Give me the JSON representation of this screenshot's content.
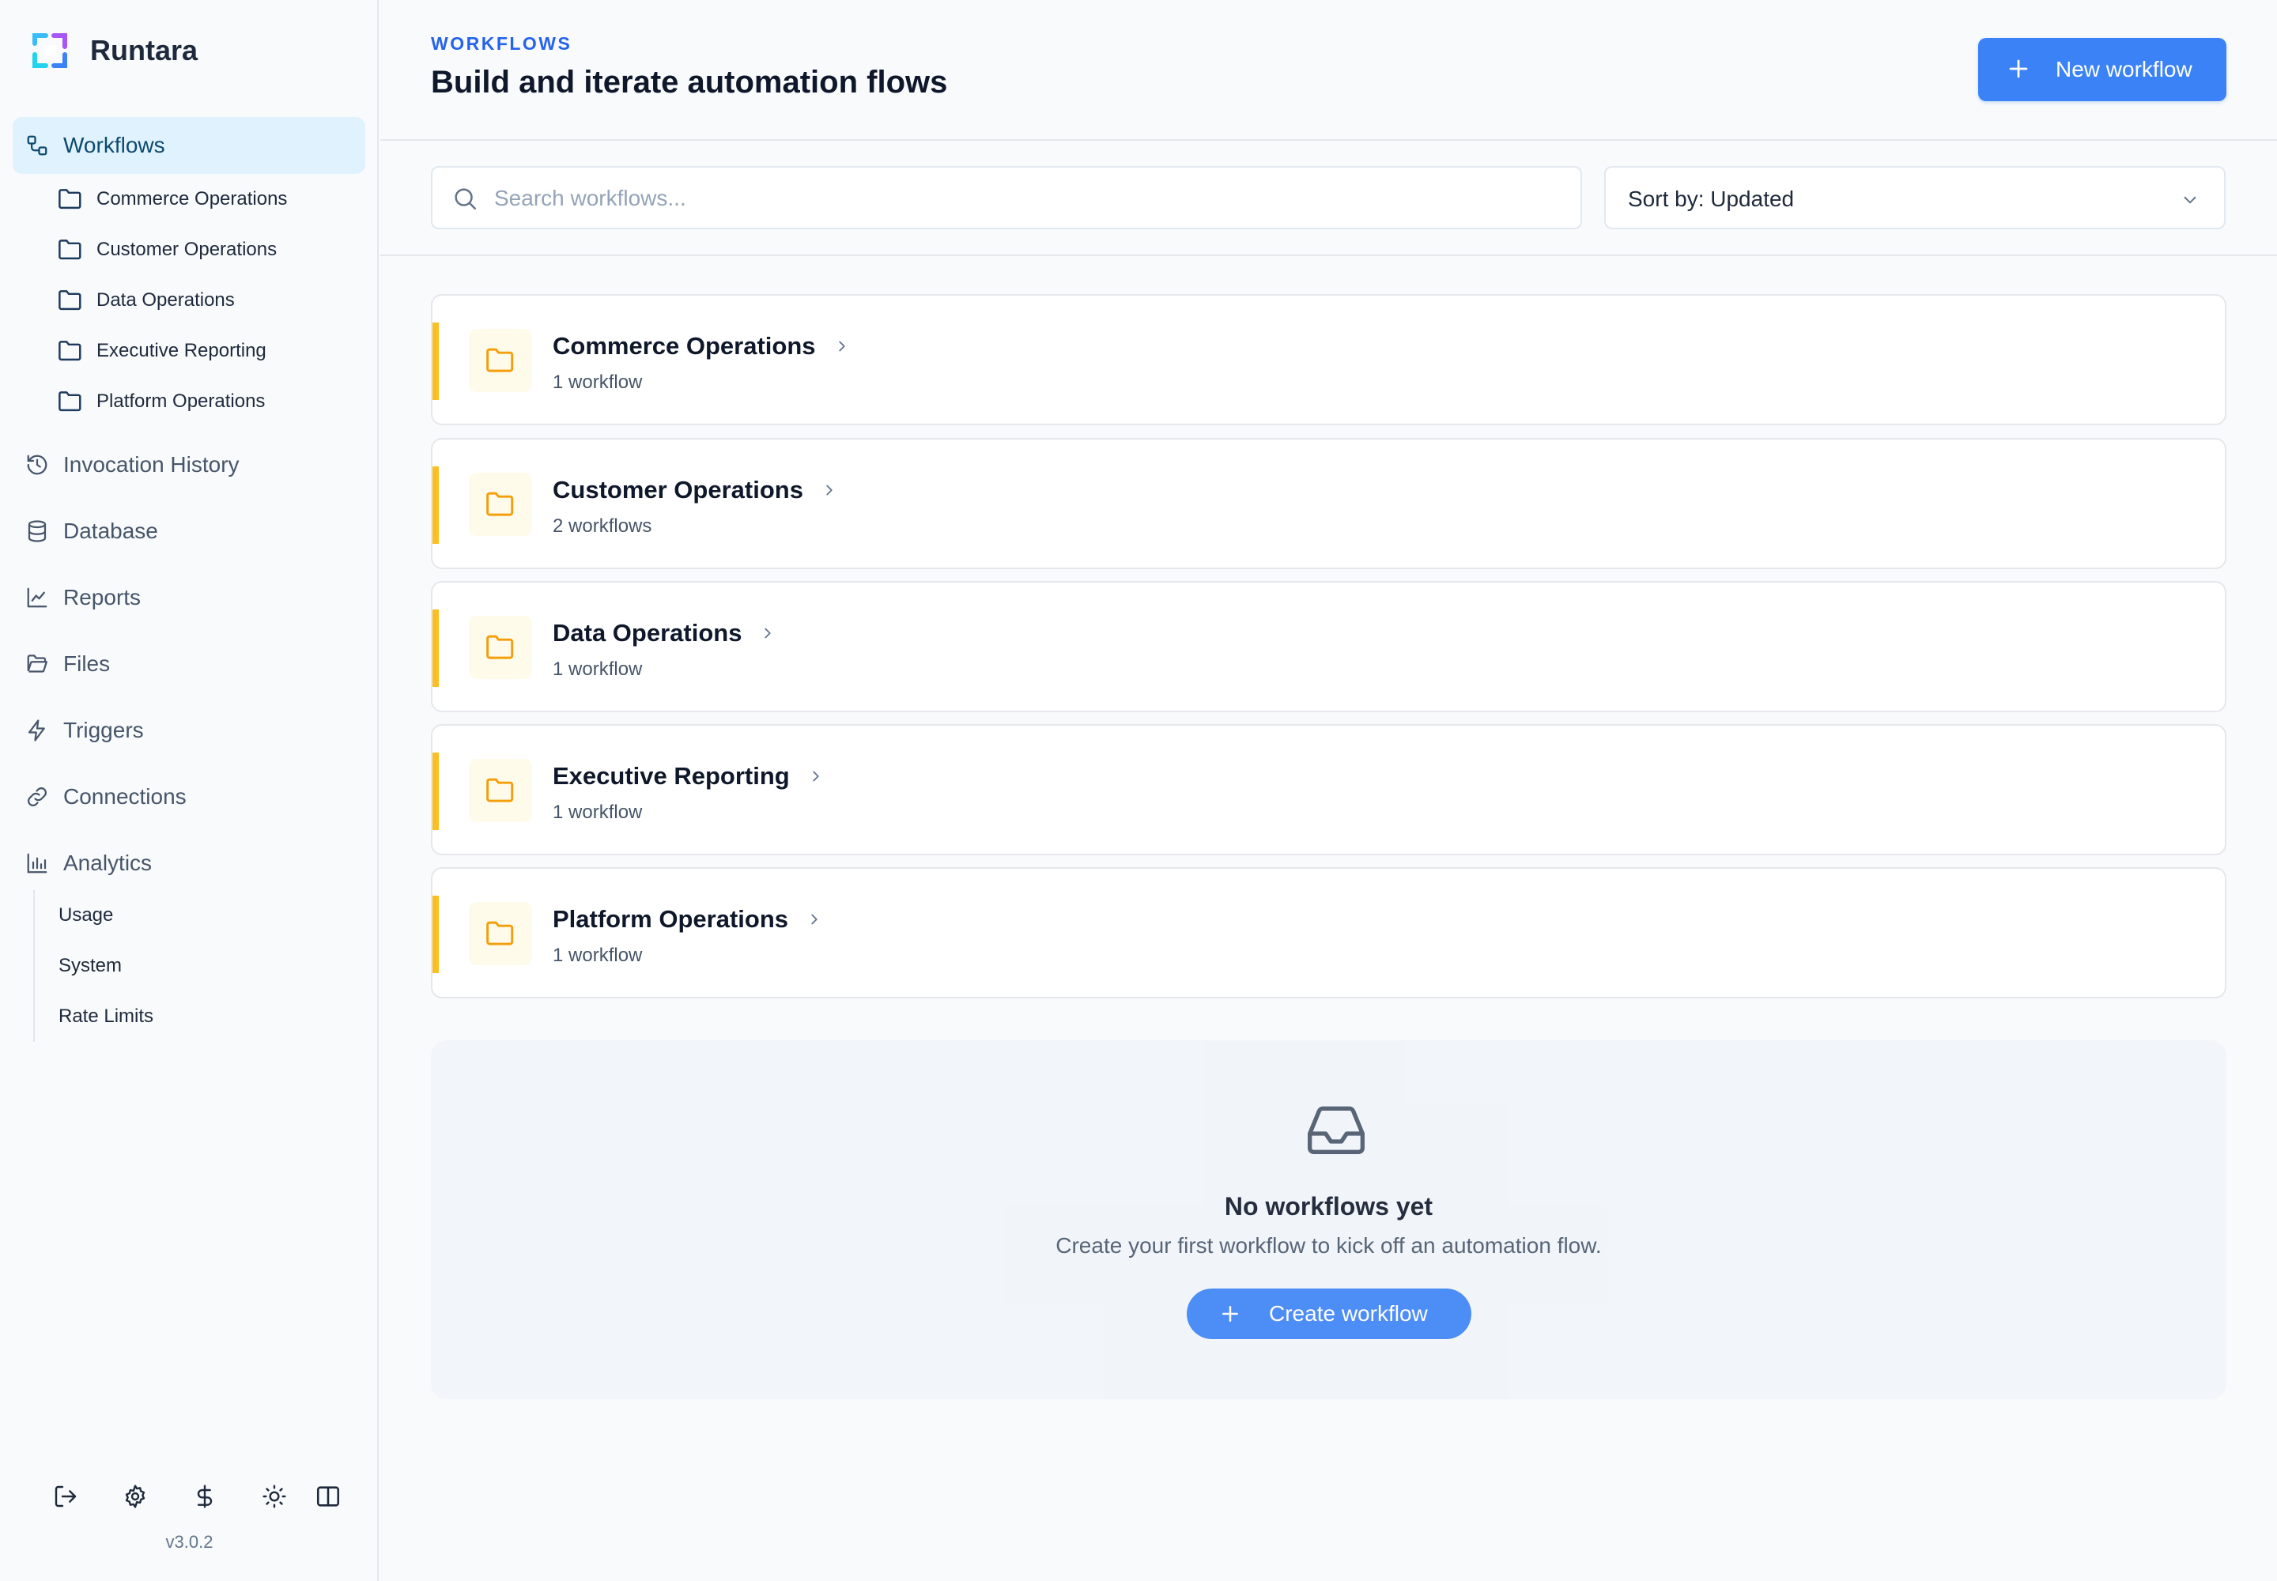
{
  "app": {
    "name": "Runtara",
    "version": "v3.0.2"
  },
  "sidebar": {
    "active": {
      "label": "Workflows",
      "icon": "workflow-icon"
    },
    "folders": [
      {
        "label": "Commerce Operations",
        "icon": "folder-icon"
      },
      {
        "label": "Customer Operations",
        "icon": "folder-icon"
      },
      {
        "label": "Data Operations",
        "icon": "folder-icon"
      },
      {
        "label": "Executive Reporting",
        "icon": "folder-icon"
      },
      {
        "label": "Platform Operations",
        "icon": "folder-icon"
      }
    ],
    "items": [
      {
        "label": "Invocation History",
        "icon": "history-icon"
      },
      {
        "label": "Database",
        "icon": "database-icon"
      },
      {
        "label": "Reports",
        "icon": "line-chart-icon"
      },
      {
        "label": "Files",
        "icon": "folder-open-icon"
      },
      {
        "label": "Triggers",
        "icon": "lightning-icon"
      },
      {
        "label": "Connections",
        "icon": "link-icon"
      },
      {
        "label": "Analytics",
        "icon": "bar-chart-icon"
      }
    ],
    "analytics_sub": [
      {
        "label": "Usage"
      },
      {
        "label": "System"
      },
      {
        "label": "Rate Limits"
      }
    ],
    "bottom_icons": [
      "logout-icon",
      "settings-icon",
      "dollar-icon",
      "sun-icon",
      "panel-toggle-icon"
    ]
  },
  "header": {
    "eyebrow": "WORKFLOWS",
    "title": "Build and iterate automation flows",
    "new_button": "New workflow"
  },
  "toolbar": {
    "search_placeholder": "Search workflows...",
    "sort_label": "Sort by: Updated"
  },
  "folders": [
    {
      "name": "Commerce Operations",
      "count": "1 workflow"
    },
    {
      "name": "Customer Operations",
      "count": "2 workflows"
    },
    {
      "name": "Data Operations",
      "count": "1 workflow"
    },
    {
      "name": "Executive Reporting",
      "count": "1 workflow"
    },
    {
      "name": "Platform Operations",
      "count": "1 workflow"
    }
  ],
  "empty_state": {
    "icon": "inbox-icon",
    "title": "No workflows yet",
    "description": "Create your first workflow to kick off an automation flow.",
    "button": "Create workflow"
  },
  "colors": {
    "accent": "#3b82f6",
    "eyebrow": "#2563eb",
    "folder_accent": "#fbbf24",
    "active_nav_bg": "#e0f2fe"
  }
}
